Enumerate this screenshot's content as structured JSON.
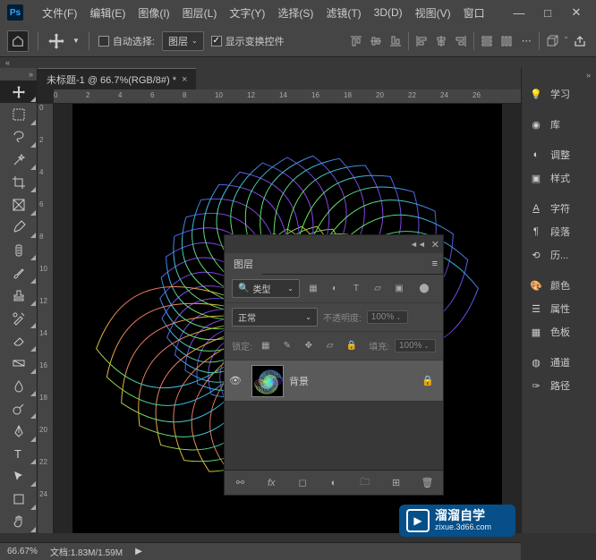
{
  "titlebar": {
    "logo": "Ps"
  },
  "menu": {
    "items": [
      "文件(F)",
      "编辑(E)",
      "图像(I)",
      "图层(L)",
      "文字(Y)",
      "选择(S)",
      "滤镜(T)",
      "3D(D)",
      "视图(V)",
      "窗口"
    ]
  },
  "options": {
    "auto_select_label": "自动选择:",
    "target_select": "图层",
    "show_transform_label": "显示变换控件"
  },
  "doc": {
    "tab_title": "未标题-1 @ 66.7%(RGB/8#) *"
  },
  "right_panels": {
    "items": [
      {
        "icon": "bulb",
        "label": "学习"
      },
      {
        "icon": "cc",
        "label": "库"
      },
      {
        "icon": "contrast",
        "label": "调整"
      },
      {
        "icon": "frame",
        "label": "样式"
      },
      {
        "icon": "char",
        "label": "字符"
      },
      {
        "icon": "para",
        "label": "段落"
      },
      {
        "icon": "history",
        "label": "历..."
      },
      {
        "icon": "palette",
        "label": "颜色"
      },
      {
        "icon": "props",
        "label": "属性"
      },
      {
        "icon": "swatch",
        "label": "色板"
      },
      {
        "icon": "channels",
        "label": "通道"
      },
      {
        "icon": "paths",
        "label": "路径"
      }
    ]
  },
  "layers_panel": {
    "title": "图层",
    "kind_label": "类型",
    "blend_mode": "正常",
    "opacity_label": "不透明度:",
    "opacity_value": "100%",
    "lock_label": "锁定:",
    "fill_label": "填充:",
    "fill_value": "100%",
    "layer_name": "背景"
  },
  "status": {
    "zoom": "66.67%",
    "doc_label": "文档:",
    "doc_size": "1.83M/1.59M"
  },
  "watermark": {
    "title": "溜溜自学",
    "url": "zixue.3d66.com"
  },
  "ruler_marks_h": [
    "0",
    "2",
    "4",
    "6",
    "8",
    "10",
    "12",
    "14",
    "16",
    "18",
    "20",
    "22",
    "24",
    "26"
  ],
  "ruler_marks_v": [
    "0",
    "2",
    "4",
    "6",
    "8",
    "10",
    "12",
    "14",
    "16",
    "18",
    "20",
    "22",
    "24"
  ]
}
